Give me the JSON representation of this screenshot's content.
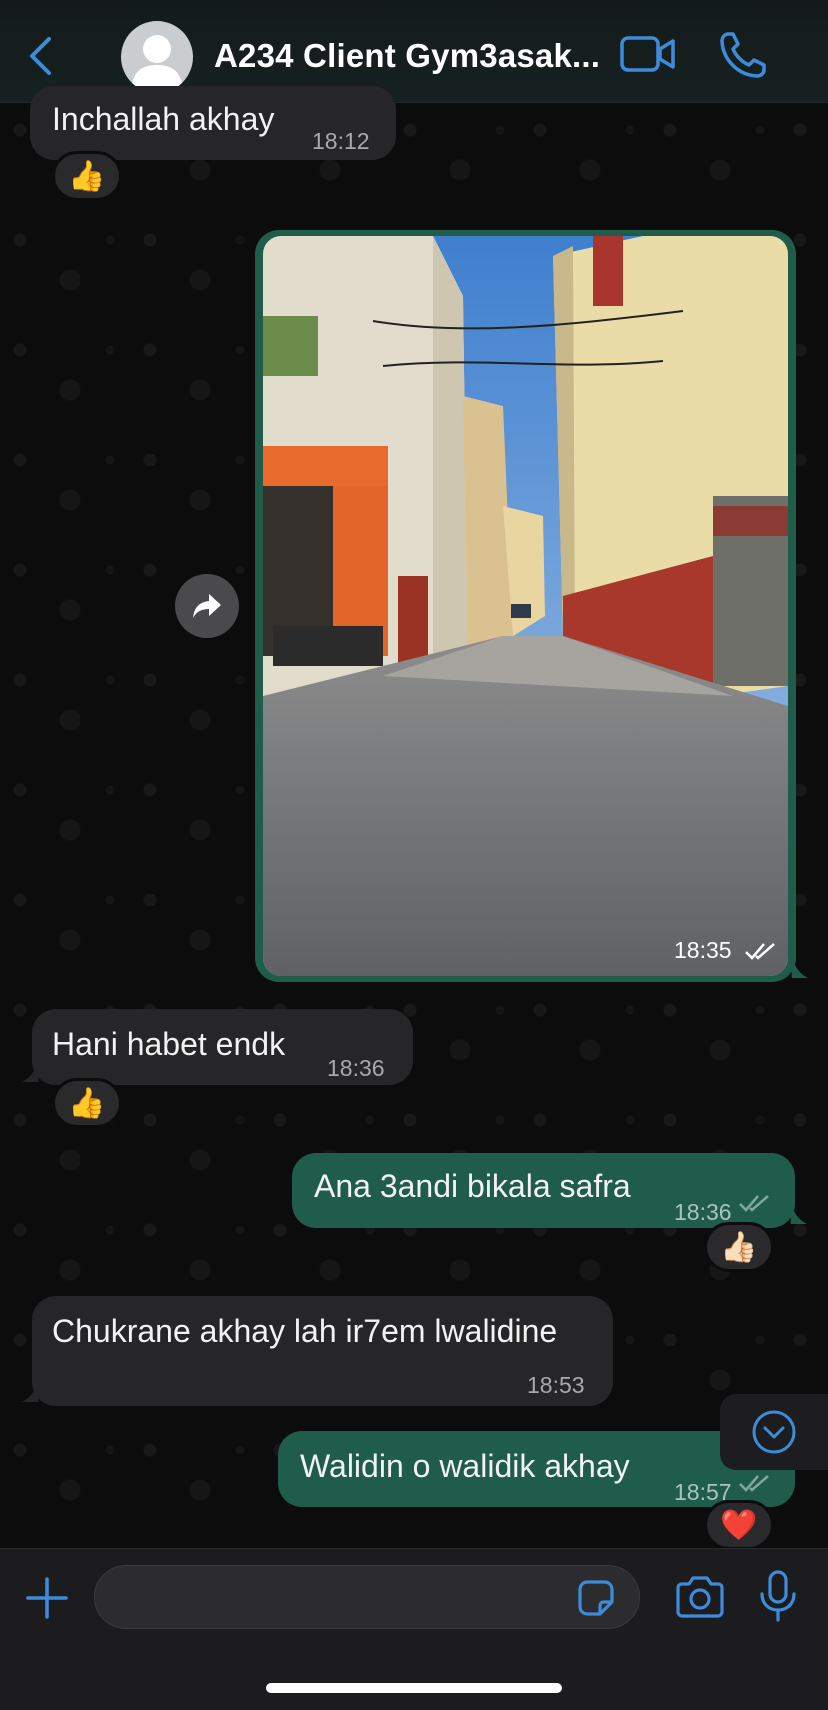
{
  "header": {
    "back_icon": "chevron-left-icon",
    "title": "A234 Client Gym3asak...",
    "video_icon": "video-camera-icon",
    "call_icon": "phone-icon",
    "accent_color": "#3d8cdb"
  },
  "messages": [
    {
      "direction": "incoming",
      "text": "Inchallah akhay",
      "time": "18:12",
      "reaction": "👍"
    },
    {
      "direction": "outgoing",
      "type": "image",
      "time": "18:35",
      "status": "read"
    },
    {
      "direction": "incoming",
      "text": "Hani habet endk",
      "time": "18:36",
      "reaction": "👍"
    },
    {
      "direction": "outgoing",
      "text": "Ana 3andi bikala safra",
      "time": "18:36",
      "status": "delivered",
      "reaction": "👍🏻"
    },
    {
      "direction": "incoming",
      "text": "Chukrane akhay lah ir7em lwalidine",
      "time": "18:53"
    },
    {
      "direction": "outgoing",
      "text": "Walidin o walidik akhay",
      "time": "18:57",
      "status": "delivered",
      "reaction": "❤️"
    }
  ],
  "composer": {
    "placeholder": "",
    "plus_icon": "plus-icon",
    "sticker_icon": "sticker-icon",
    "camera_icon": "camera-icon",
    "mic_icon": "microphone-icon"
  },
  "colors": {
    "incoming_bubble": "#262628",
    "outgoing_bubble": "#1f5c4a",
    "background": "#0c0c0c"
  }
}
